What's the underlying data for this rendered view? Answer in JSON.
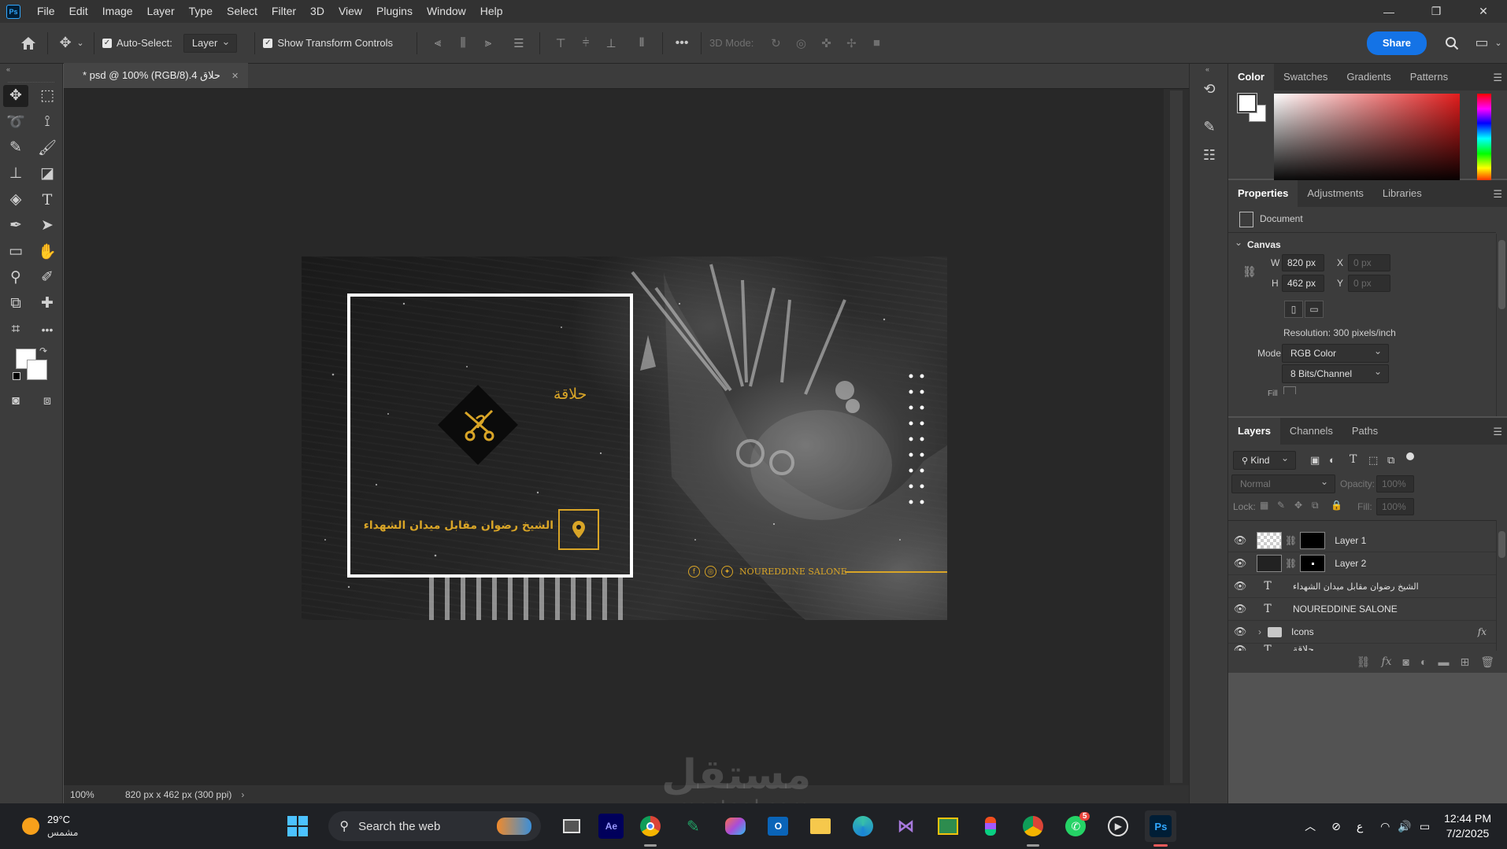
{
  "menubar": {
    "logo": "Ps",
    "items": [
      "File",
      "Edit",
      "Image",
      "Layer",
      "Type",
      "Select",
      "Filter",
      "3D",
      "View",
      "Plugins",
      "Window",
      "Help"
    ]
  },
  "options": {
    "auto_select_label": "Auto-Select:",
    "auto_select_value": "Layer",
    "show_transform_label": "Show Transform Controls",
    "mode_3d_label": "3D Mode:",
    "share_label": "Share"
  },
  "document": {
    "tab_title": "حلاق 4.psd @ 100% (RGB/8) *",
    "zoom": "100%",
    "status_info": "820 px x 462 px (300 ppi)"
  },
  "artwork": {
    "brand_arabic": "حلاقة",
    "address_arabic": "الشيخ رضوان مقابل ميدان الشهداء",
    "salon_name": "NOUREDDINE SALONE",
    "social_icons": [
      "facebook-icon",
      "instagram-icon",
      "twitter-icon"
    ],
    "gold_color": "#d9a527"
  },
  "color_panel": {
    "tabs": [
      "Color",
      "Swatches",
      "Gradients",
      "Patterns"
    ]
  },
  "properties_panel": {
    "tabs": [
      "Properties",
      "Adjustments",
      "Libraries"
    ],
    "document_label": "Document",
    "canvas_heading": "Canvas",
    "w_label": "W",
    "w_value": "820 px",
    "h_label": "H",
    "h_value": "462 px",
    "x_label": "X",
    "x_placeholder": "0 px",
    "y_label": "Y",
    "y_placeholder": "0 px",
    "resolution": "Resolution: 300 pixels/inch",
    "mode_label": "Mode",
    "mode_value": "RGB Color",
    "depth_value": "8 Bits/Channel",
    "fill_label": "Fill"
  },
  "layers_panel": {
    "tabs": [
      "Layers",
      "Channels",
      "Paths"
    ],
    "filter_kind": "Kind",
    "blend_mode": "Normal",
    "opacity_label": "Opacity:",
    "opacity_value": "100%",
    "lock_label": "Lock:",
    "fill_label": "Fill:",
    "fill_value": "100%",
    "layers": [
      {
        "name": "Layer 1",
        "type": "image"
      },
      {
        "name": "Layer 2",
        "type": "image"
      },
      {
        "name": "الشيخ رضوان مقابل ميدان الشهداء",
        "type": "text"
      },
      {
        "name": "NOUREDDINE SALONE",
        "type": "text"
      },
      {
        "name": "Icons",
        "type": "group"
      },
      {
        "name": "حلاقة",
        "type": "text"
      }
    ]
  },
  "taskbar": {
    "temperature": "29°C",
    "weather_text": "مشمس",
    "search_placeholder": "Search the web",
    "whatsapp_badge": "5",
    "tray_lang": "ع",
    "time": "12:44 PM",
    "date": "7/2/2025"
  },
  "watermark": {
    "text": "مستقل",
    "sub": "mostaql.com"
  }
}
